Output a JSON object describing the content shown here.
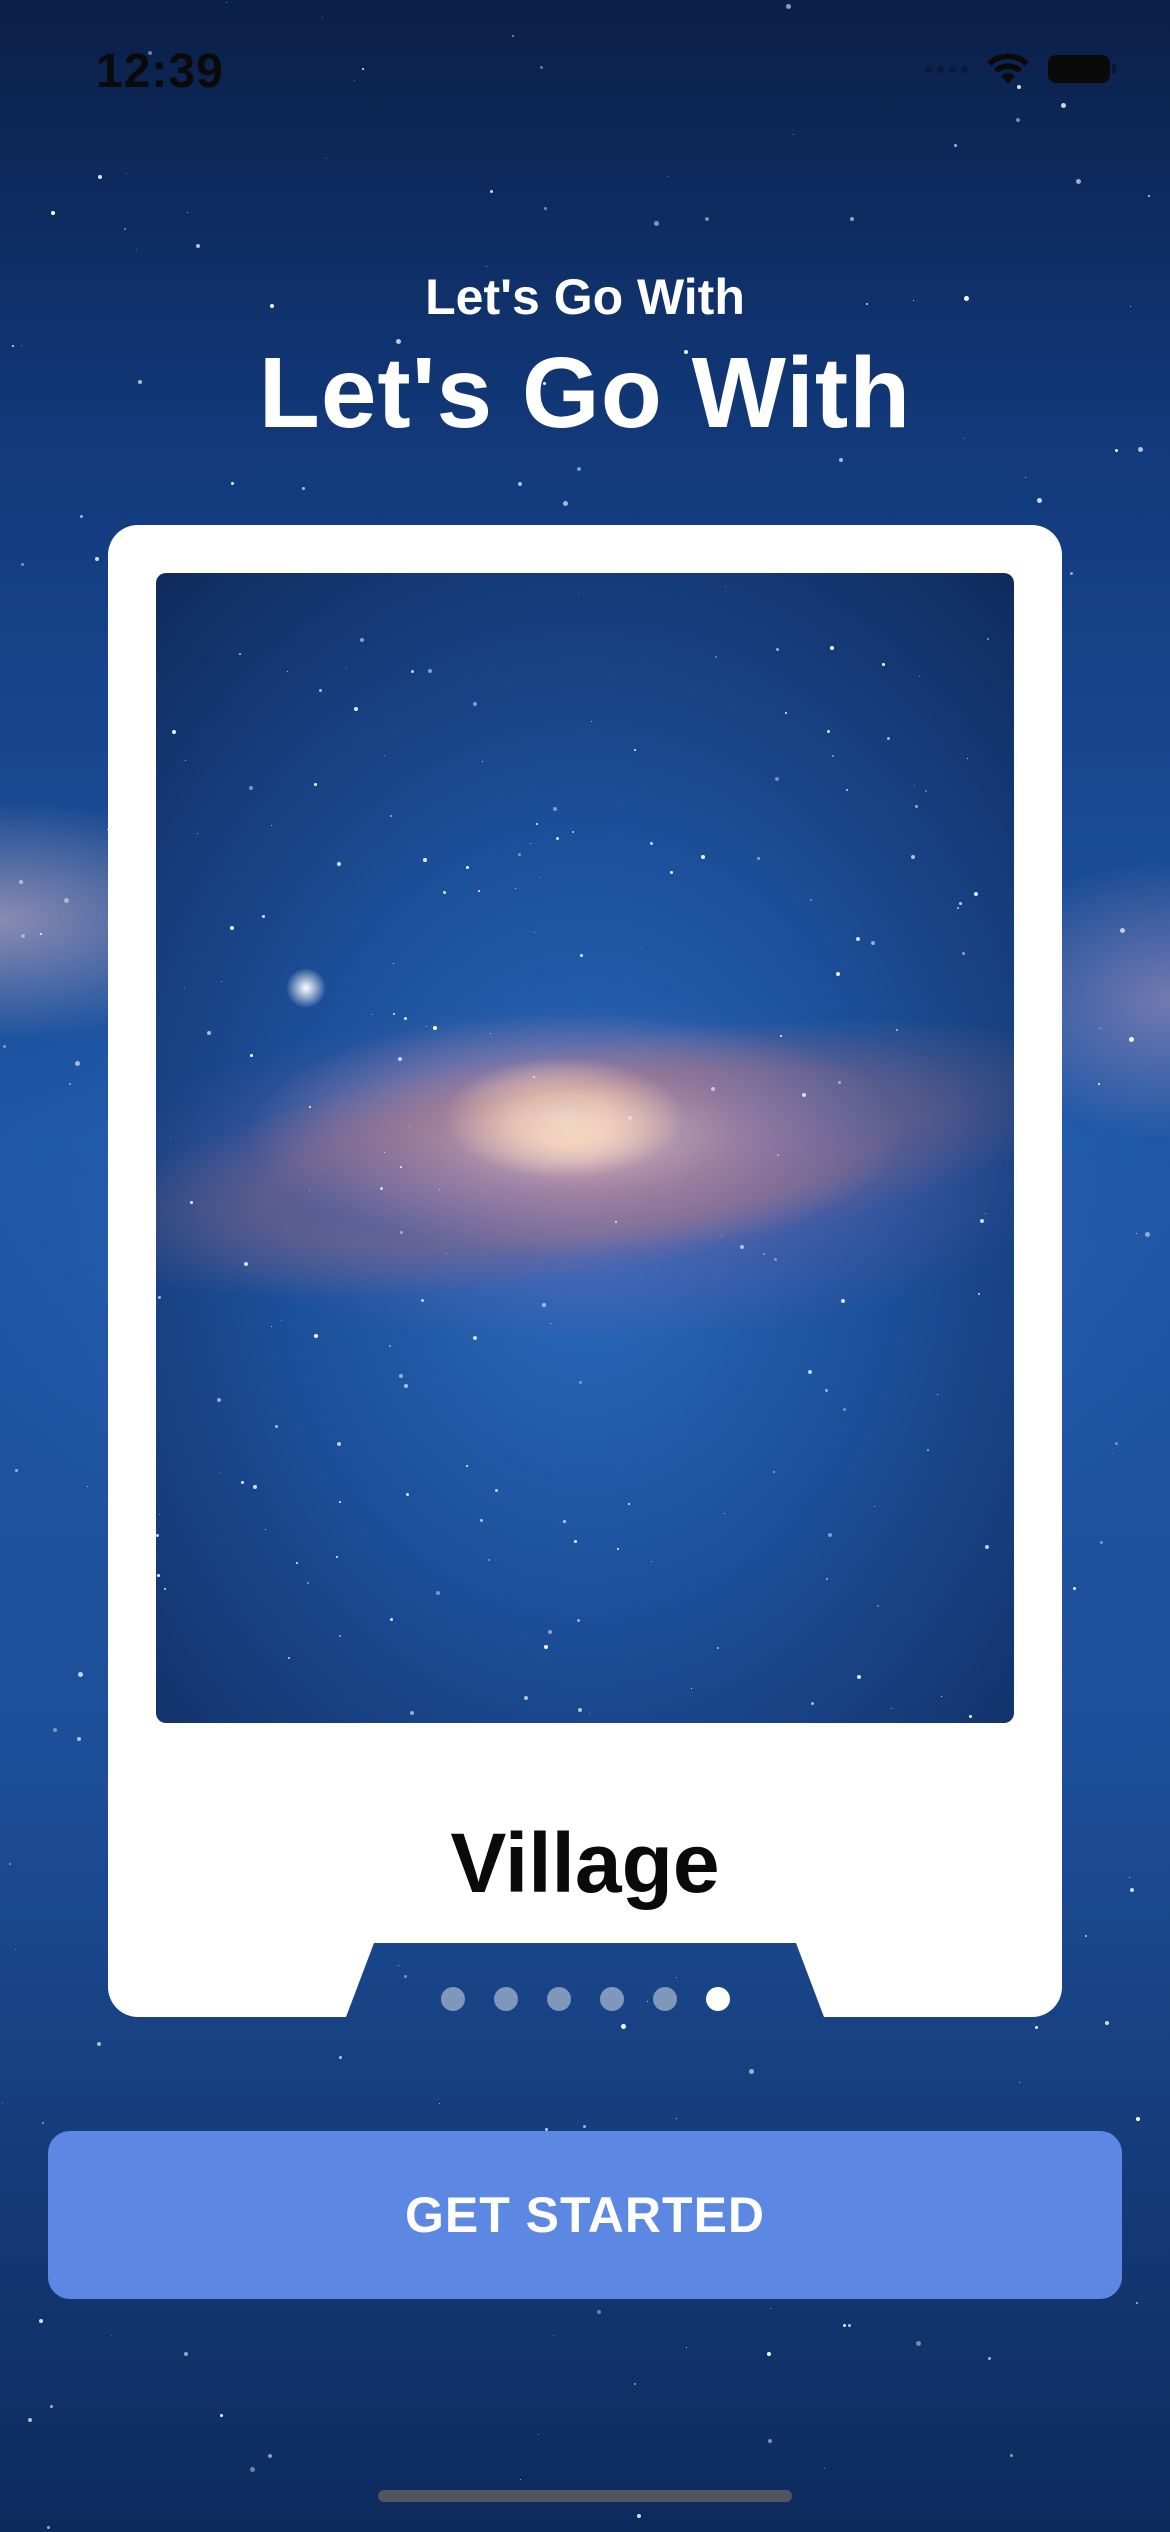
{
  "status_bar": {
    "time": "12:39",
    "icons": [
      "wifi-icon",
      "battery-icon"
    ]
  },
  "header": {
    "subtitle": "Let's Go With",
    "title": "Let's Go With"
  },
  "card": {
    "image": "galaxy-image",
    "title": "Village",
    "pagination": {
      "total": 6,
      "active_index": 5
    }
  },
  "cta": {
    "label": "GET STARTED"
  },
  "colors": {
    "button": "#5c88e4",
    "card": "#ffffff",
    "background": "#1f57a6"
  }
}
